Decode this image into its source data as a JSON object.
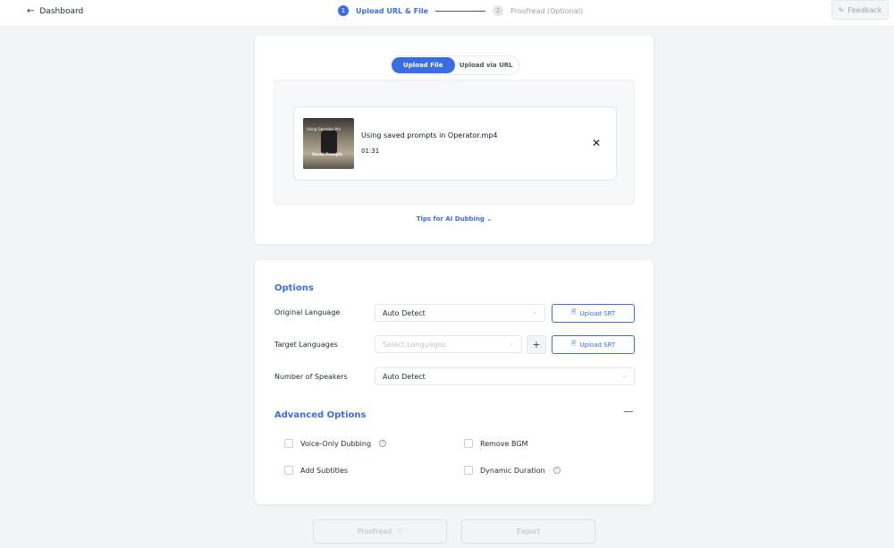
{
  "header": {
    "back_label": "Dashboard",
    "steps": [
      {
        "num": "1",
        "label": "Upload URL & File"
      },
      {
        "num": "2",
        "label": "Proofread (Optional)"
      }
    ],
    "feedback_label": "Feedback"
  },
  "upload": {
    "tabs": [
      "Upload File",
      "Upload via URL"
    ],
    "file": {
      "name": "Using saved prompts in Operator.mp4",
      "duration": "01:31",
      "thumb_title": "Using Operator Pro",
      "thumb_caption": "Saved Prompts"
    },
    "tips_label": "Tips for AI Dubbing"
  },
  "options": {
    "title": "Options",
    "original_language": {
      "label": "Original Language",
      "value": "Auto Detect"
    },
    "target_languages": {
      "label": "Target Languages",
      "placeholder": "Select Languages"
    },
    "speakers": {
      "label": "Number of Speakers",
      "value": "Auto Detect"
    },
    "upload_srt_label": "Upload SRT"
  },
  "advanced": {
    "title": "Advanced Options",
    "items": [
      "Voice-Only Dubbing",
      "Remove BGM",
      "Add Subtitles",
      "Dynamic Duration"
    ]
  },
  "actions": {
    "proofread_label": "Proofread",
    "export_label": "Export"
  },
  "colors": {
    "accent": "#3b6ce0",
    "background": "#f3f4f6"
  }
}
